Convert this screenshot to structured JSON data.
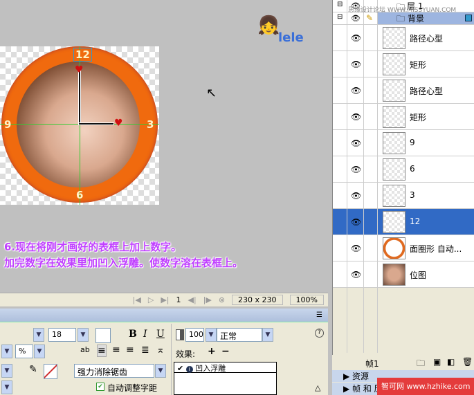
{
  "canvas": {
    "instruction_lines": [
      "6.现在将刚才画好的表框上加上数字。",
      "加完数字在效果里加凹入浮雕。使数字溶在表框上。"
    ],
    "clock_numbers": {
      "top": "12",
      "left": "9",
      "right": "3",
      "bottom": "6"
    },
    "logo_text": "lele"
  },
  "statusbar": {
    "frame": "1",
    "size": "230 x 230",
    "zoom": "100%"
  },
  "properties": {
    "font_size": "18",
    "tracking_unit": "%",
    "opacity": "100",
    "blend_mode": "正常",
    "bold": "B",
    "italic": "I",
    "underline": "U",
    "anti_alias": "强力消除锯齿",
    "auto_kern_label": "自动调整字距",
    "auto_kern_checked": true,
    "effects_label": "效果:",
    "effects": [
      {
        "name": "凹入浮雕",
        "enabled": true
      }
    ],
    "help": "?"
  },
  "layers": {
    "watermark": "思缘设计论坛 WWW.MISSYUAN.COM",
    "groups": [
      {
        "name": "层 1"
      },
      {
        "name": "背景"
      }
    ],
    "items": [
      {
        "name": "路径心型"
      },
      {
        "name": "矩形"
      },
      {
        "name": "路径心型"
      },
      {
        "name": "矩形"
      },
      {
        "name": "9"
      },
      {
        "name": "6"
      },
      {
        "name": "3"
      },
      {
        "name": "12",
        "selected": true
      },
      {
        "name": "面圈形 自动..."
      },
      {
        "name": "位图"
      }
    ],
    "frame_label": "帧1",
    "collapsed_panels": [
      "资源",
      "帧 和 历史记录"
    ]
  },
  "brand_watermark": "智可网 www.hzhike.com",
  "colors": {
    "selection": "#316ac5",
    "ring": "#f06a0e",
    "instruction": "#c040ff"
  }
}
